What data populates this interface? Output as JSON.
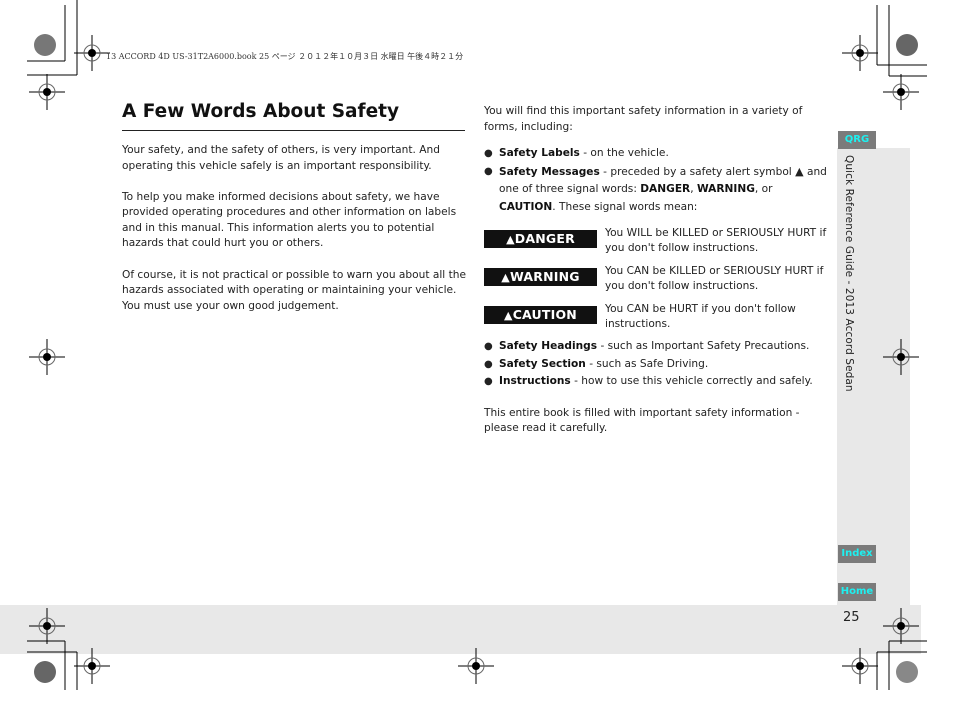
{
  "print_header": "13 ACCORD 4D US-31T2A6000.book  25 ページ  ２０１２年１０月３日  水曜日  午後４時２１分",
  "title": "A Few Words About Safety",
  "left_paragraphs": [
    "Your safety, and the safety of others, is very important. And operating this vehicle safely is an important responsibility.",
    "To help you make informed decisions about safety, we have provided operating procedures and other information on labels and in this manual. This information alerts you to potential hazards that could hurt you or others.",
    "Of course, it is not practical or possible to warn you about all the hazards associated with operating or maintaining your vehicle. You must use your own good judgement."
  ],
  "right_intro": "You will find this important safety information in a variety of forms, including:",
  "bullets_top": [
    {
      "bold": "Safety Labels",
      "text": " - on the vehicle."
    },
    {
      "bold": "Safety Messages",
      "text": " - preceded by a safety alert symbol ",
      "icon": "▲",
      "text2": " and one of three signal words: ",
      "w1": "DANGER",
      "sep1": ", ",
      "w2": "WARNING",
      "sep2": ", or ",
      "w3": "CAUTION",
      "text3": ". These signal words mean:"
    }
  ],
  "signals": [
    {
      "label": "DANGER",
      "icon": "▲",
      "desc": "You WILL be KILLED or SERIOUSLY HURT if you don't follow instructions."
    },
    {
      "label": "WARNING",
      "icon": "▲",
      "desc": "You CAN be KILLED or SERIOUSLY HURT if you don't follow instructions."
    },
    {
      "label": "CAUTION",
      "icon": "▲",
      "desc": "You CAN be HURT if you don't follow instructions."
    }
  ],
  "bullets_bottom": [
    {
      "bold": "Safety Headings",
      "text": " - such as Important Safety Precautions."
    },
    {
      "bold": "Safety Section",
      "text": " - such as Safe Driving."
    },
    {
      "bold": "Instructions",
      "text": " - how to use this vehicle correctly and safely."
    }
  ],
  "closing": "This entire book is filled with important safety information - please read it carefully.",
  "sidebar": {
    "qrg_tab": "QRG",
    "vertical_title": "Quick Reference Guide - 2013 Accord Sedan",
    "index_tab": "Index",
    "home_tab": "Home",
    "tab_text_color": "#1ef0f0",
    "tab_bg_color": "#7b7b7b"
  },
  "page_number": "25"
}
